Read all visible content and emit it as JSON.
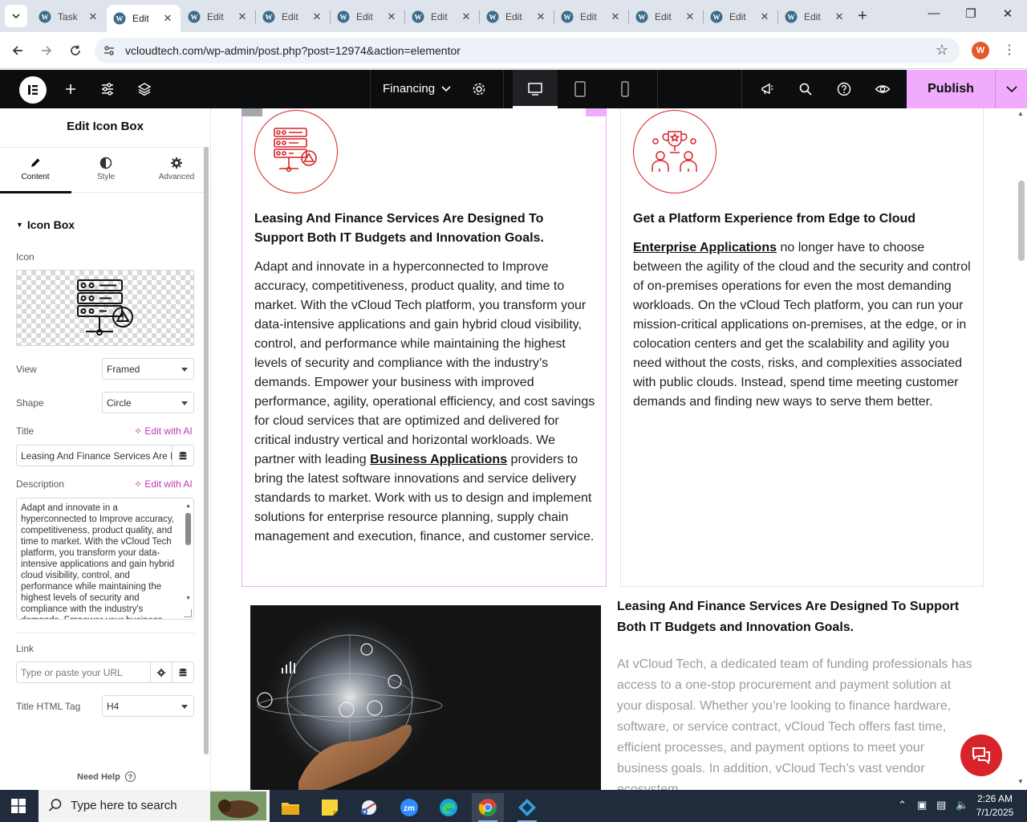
{
  "browser": {
    "tabs": [
      {
        "label": "Task",
        "favicon": "wp-icon",
        "active": false
      },
      {
        "label": "Edit",
        "favicon": "wp-icon",
        "active": true
      },
      {
        "label": "Edit",
        "favicon": "wp-icon",
        "active": false
      },
      {
        "label": "Edit",
        "favicon": "wp-icon",
        "active": false
      },
      {
        "label": "Edit",
        "favicon": "wp-icon",
        "active": false
      },
      {
        "label": "Edit",
        "favicon": "wp-icon",
        "active": false
      },
      {
        "label": "Edit",
        "favicon": "wp-icon",
        "active": false
      },
      {
        "label": "Edit",
        "favicon": "wp-icon",
        "active": false
      },
      {
        "label": "Edit",
        "favicon": "wp-icon",
        "active": false
      },
      {
        "label": "Edit",
        "favicon": "wp-icon",
        "active": false
      },
      {
        "label": "Edit",
        "favicon": "wp-icon",
        "active": false
      }
    ],
    "url": "vcloudtech.com/wp-admin/post.php?post=12974&action=elementor",
    "profile_initial": "W"
  },
  "elementor": {
    "page_name": "Financing",
    "publish_label": "Publish"
  },
  "panel": {
    "title": "Edit Icon Box",
    "tabs": [
      {
        "label": "Content",
        "icon": "pencil-icon"
      },
      {
        "label": "Style",
        "icon": "half-circle-icon"
      },
      {
        "label": "Advanced",
        "icon": "gear-icon"
      }
    ],
    "section_title": "Icon Box",
    "icon_label": "Icon",
    "view_label": "View",
    "view_value": "Framed",
    "shape_label": "Shape",
    "shape_value": "Circle",
    "title_label": "Title",
    "edit_with_ai": "Edit with AI",
    "title_value": "Leasing And Finance Services Are Designed To Support Both IT Budgets and Innovation Goals.",
    "description_label": "Description",
    "description_value": "Adapt and innovate in a hyperconnected to Improve accuracy, competitiveness, product quality, and time to market. With the vCloud Tech platform, you transform your data-intensive applications and gain hybrid cloud visibility, control, and performance while maintaining the highest levels of security and compliance with the industry's demands. Empower your business",
    "link_label": "Link",
    "link_placeholder": "Type or paste your URL",
    "title_html_tag_label": "Title HTML Tag",
    "title_html_tag_value": "H4",
    "need_help": "Need Help"
  },
  "canvas": {
    "card1": {
      "title": "Leasing And Finance Services Are Designed To Support Both IT Budgets and Innovation Goals.",
      "desc_part1": "Adapt and innovate in a hyperconnected to Improve accuracy, competitiveness, product quality, and time to market. With the vCloud Tech platform, you transform your data-intensive applications and gain hybrid cloud visibility, control, and performance while maintaining the highest levels of security and compliance with the industry’s demands. Empower your business with improved performance, agility, operational efficiency, and cost savings for cloud services that are optimized and delivered for critical industry vertical and horizontal workloads. We partner with leading ",
      "desc_link": "Business Applications",
      "desc_part2": " providers to bring the latest software innovations and service delivery standards to market. Work with us to design and implement solutions for enterprise resource planning, supply chain management and execution, finance, and customer service."
    },
    "card2": {
      "title": "Get a Platform Experience from Edge to Cloud",
      "desc_link": "Enterprise Applications",
      "desc_rest": " no longer have to choose between the agility of the cloud and the security and control of on-premises operations for even the most demanding workloads. On the vCloud Tech platform, you can run your mission-critical applications on-premises, at the edge, or in colocation centers and get the scalability and agility you need without the costs, risks, and complexities associated with public clouds. Instead, spend time meeting customer demands and finding new ways to serve them better."
    },
    "section2": {
      "title": "Leasing And Finance Services Are Designed To Support Both IT Budgets and Innovation Goals.",
      "body": "At vCloud Tech, a dedicated team of funding professionals has access to a one-stop procurement and payment solution at your disposal. Whether you’re looking to finance hardware, software, or service contract, vCloud Tech offers fast time, efficient processes, and payment options to meet your business goals. In addition, vCloud Tech’s vast vendor ecosystem"
    }
  },
  "taskbar": {
    "search_placeholder": "Type here to search",
    "time": "2:26 AM",
    "date": "7/1/2025"
  },
  "colors": {
    "accent_pink": "#f0abfc",
    "brand_red": "#d8232a",
    "ai_link": "#c036b4"
  }
}
